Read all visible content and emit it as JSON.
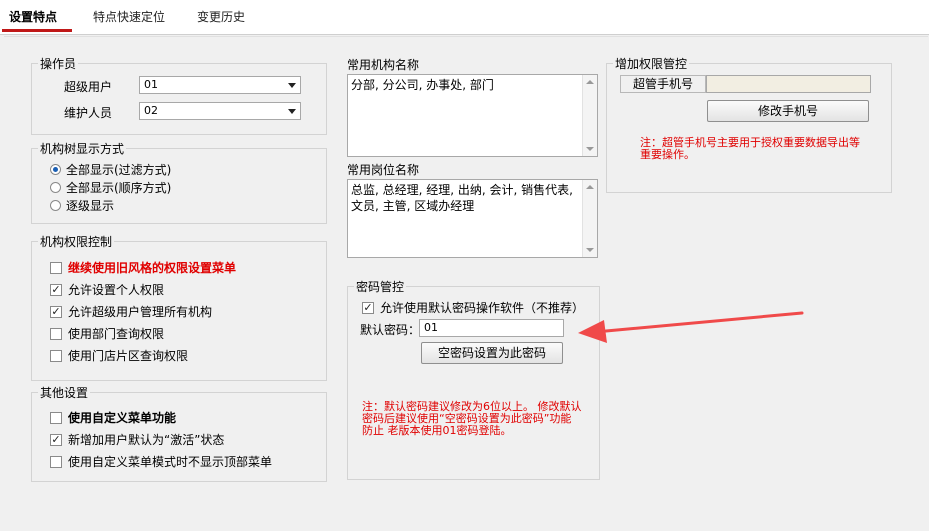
{
  "tabs": [
    {
      "label": "设置特点"
    },
    {
      "label": "特点快速定位"
    },
    {
      "label": "变更历史"
    }
  ],
  "operator": {
    "title": "操作员",
    "super_label": "超级用户",
    "super_value": "01",
    "maint_label": "维护人员",
    "maint_value": "02"
  },
  "org_tree": {
    "title": "机构树显示方式",
    "options": [
      "全部显示(过滤方式)",
      "全部显示(顺序方式)",
      "逐级显示"
    ],
    "selected": "全部显示(过滤方式)"
  },
  "org_perm": {
    "title": "机构权限控制",
    "items": [
      {
        "label": "继续使用旧风格的权限设置菜单",
        "checked": false
      },
      {
        "label": "允许设置个人权限",
        "checked": true
      },
      {
        "label": "允许超级用户管理所有机构",
        "checked": true
      },
      {
        "label": "使用部门查询权限",
        "checked": false
      },
      {
        "label": "使用门店片区查询权限",
        "checked": false
      }
    ]
  },
  "other": {
    "title": "其他设置",
    "items": [
      {
        "label": "使用自定义菜单功能",
        "checked": false
      },
      {
        "label": "新增加用户默认为“激活”状态",
        "checked": true
      },
      {
        "label": "使用自定义菜单模式时不显示顶部菜单",
        "checked": false
      }
    ]
  },
  "org_names": {
    "title": "常用机构名称",
    "value": "分部, 分公司, 办事处, 部门"
  },
  "post_names": {
    "title": "常用岗位名称",
    "value": "总监, 总经理, 经理, 出纳, 会计, 销售代表, 文员, 主管, 区域办经理"
  },
  "password": {
    "title": "密码管控",
    "allow_default_label": "允许使用默认密码操作软件（不推荐）",
    "allow_default_checked": true,
    "default_label": "默认密码：",
    "default_value": "01",
    "set_button": "空密码设置为此密码",
    "note": "注：默认密码建议修改为6位以上。 修改默认密码后建议使用“空密码设置为此密码”功能防止 老版本使用01密码登陆。"
  },
  "extra_perm": {
    "title": "增加权限管控",
    "phone_label": "超管手机号",
    "phone_value": "",
    "modify_button": "修改手机号",
    "note": "注：超管手机号主要用于授权重要数据导出等重要操作。"
  },
  "colors": {
    "accent": "#c01818",
    "note": "#e00000",
    "arrow": "#f04a4a"
  }
}
